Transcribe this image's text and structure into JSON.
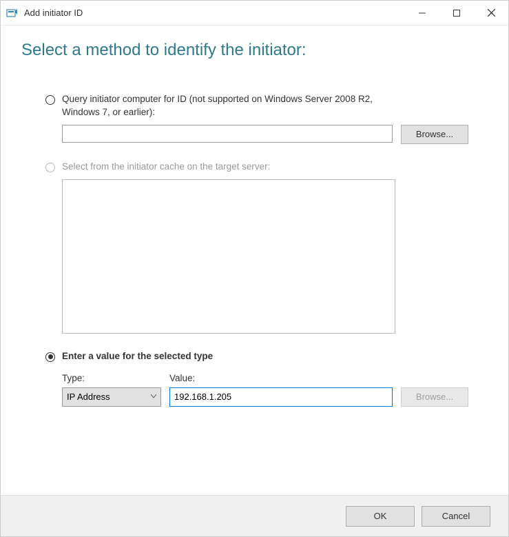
{
  "window": {
    "title": "Add initiator ID"
  },
  "heading": "Select a method to identify the initiator:",
  "options": {
    "query": {
      "label": "Query initiator computer for ID (not supported on Windows Server 2008 R2, Windows 7, or earlier):",
      "browse": "Browse...",
      "value": ""
    },
    "cache": {
      "label": "Select from the initiator cache on the target server:"
    },
    "enter": {
      "label": "Enter a value for the selected type",
      "type_label": "Type:",
      "value_label": "Value:",
      "type_selected": "IP Address",
      "value": "192.168.1.205",
      "browse": "Browse..."
    }
  },
  "footer": {
    "ok": "OK",
    "cancel": "Cancel"
  }
}
